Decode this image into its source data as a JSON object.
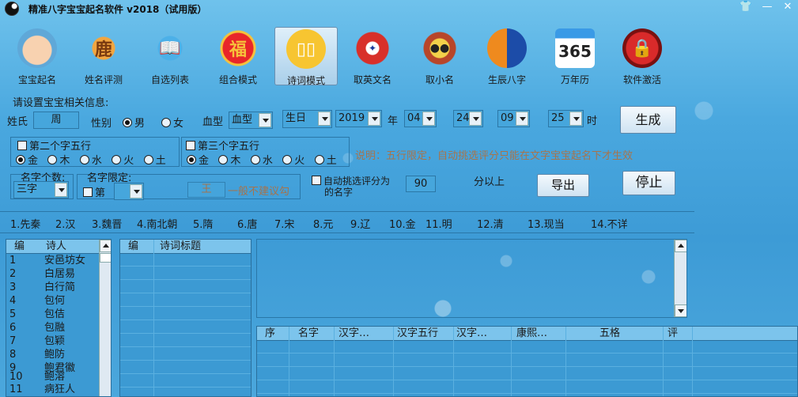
{
  "window": {
    "title": "精准八字宝宝起名软件 v2018（试用版）"
  },
  "toolbar": {
    "items": [
      {
        "label": "宝宝起名",
        "icon": "baby-icon"
      },
      {
        "label": "姓名评测",
        "icon": "deer-icon"
      },
      {
        "label": "自选列表",
        "icon": "bird-reading-icon"
      },
      {
        "label": "组合模式",
        "icon": "fu-lantern-icon"
      },
      {
        "label": "诗词模式",
        "icon": "book-icon"
      },
      {
        "label": "取英文名",
        "icon": "eagle-emblem-icon"
      },
      {
        "label": "取小名",
        "icon": "monkey-icon"
      },
      {
        "label": "生辰八字",
        "icon": "yin-yang-icon"
      },
      {
        "label": "万年历",
        "icon": "calendar-365-icon"
      },
      {
        "label": "软件激活",
        "icon": "lock-icon"
      }
    ],
    "calendar_text": "365"
  },
  "form": {
    "section_title": "请设置宝宝相关信息:",
    "surname_label": "姓氏",
    "surname_value": "周",
    "gender_label": "性别",
    "male": "男",
    "female": "女",
    "blood_label": "血型",
    "blood_value": "血型",
    "birthday_value": "生日",
    "year_value": "2019",
    "year_unit": "年",
    "month_value": "04",
    "day_value": "24",
    "hour_value": "09",
    "minute_value": "25",
    "time_unit": "时",
    "generate": "生成",
    "second_wuxing_label": "第二个字五行",
    "third_wuxing_label": "第三个字五行",
    "elements": [
      "金",
      "木",
      "水",
      "火",
      "土"
    ],
    "note": "说明：五行限定，自动挑选评分只能在文字宝宝起名下才生效",
    "name_count_label": "名字个数:",
    "name_count_value": "三字",
    "name_limit_label": "名字限定:",
    "name_limit_pos": "第",
    "name_limit_char": "王",
    "name_limit_hint": "一般不建议勾",
    "auto_pick_label": "自动挑选评分为",
    "auto_pick_label2": "的名字",
    "score_value": "90",
    "score_suffix": "分以上",
    "export": "导出",
    "stop": "停止"
  },
  "dynasties": [
    "1.先秦",
    "2.汉",
    "3.魏晋",
    "4.南北朝",
    "5.隋",
    "6.唐",
    "7.宋",
    "8.元",
    "9.辽",
    "10.金",
    "11.明",
    "12.清",
    "13.现当",
    "14.不详"
  ],
  "poets": {
    "headers": [
      "编",
      "诗人"
    ],
    "rows": [
      [
        "1",
        "安邑坊女"
      ],
      [
        "2",
        "白居易"
      ],
      [
        "3",
        "白行简"
      ],
      [
        "4",
        "包何"
      ],
      [
        "5",
        "包佶"
      ],
      [
        "6",
        "包融"
      ],
      [
        "7",
        "包颖"
      ],
      [
        "8",
        "鲍防"
      ],
      [
        "9",
        "鲍君徽"
      ],
      [
        "10",
        "鲍溶"
      ],
      [
        "11",
        "病狂人"
      ]
    ]
  },
  "poems": {
    "headers": [
      "编",
      "诗词标题"
    ]
  },
  "results": {
    "headers": [
      "序",
      "名字",
      "汉字…",
      "汉字五行",
      "汉字…",
      "康熙…",
      "五格",
      "评"
    ]
  }
}
